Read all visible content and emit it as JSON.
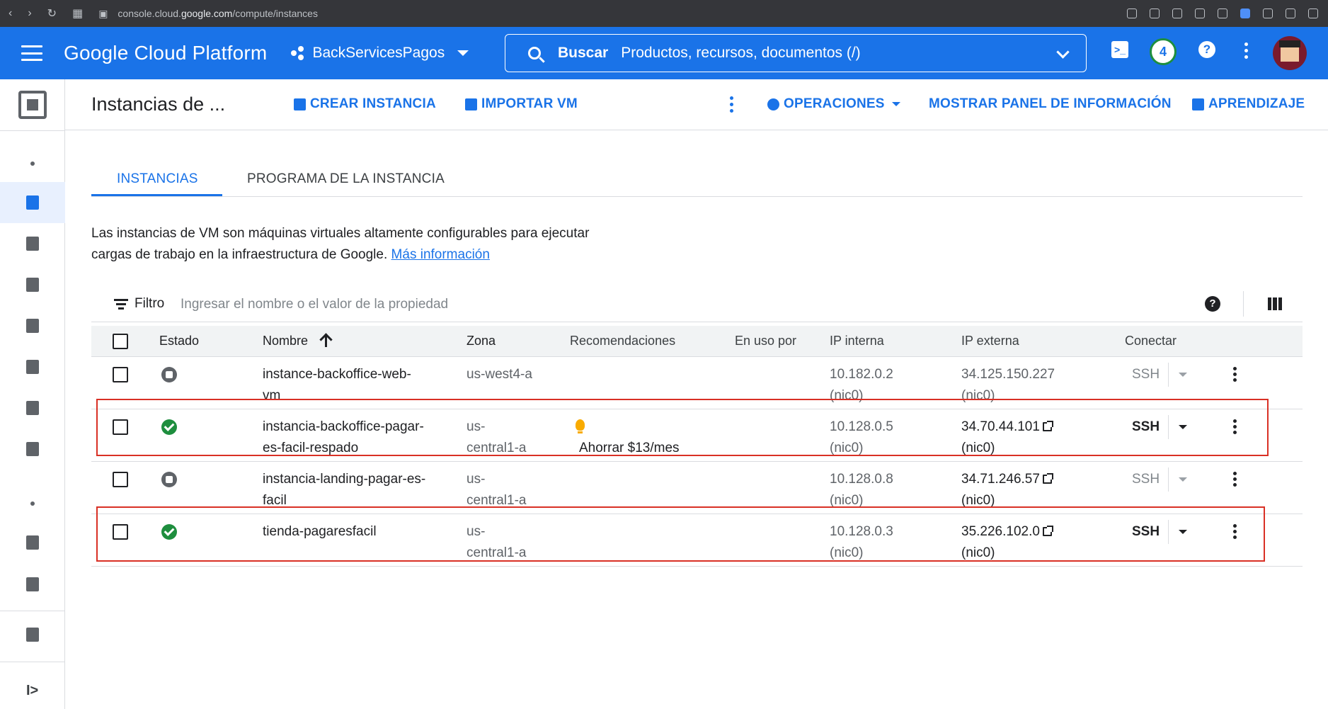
{
  "browser": {
    "url_prefix": "console.cloud.",
    "url_domain": "google.com",
    "url_path": "/compute/instances"
  },
  "header": {
    "brand": "Google Cloud Platform",
    "project": "BackServicesPagos",
    "search_label": "Buscar",
    "search_placeholder": "Productos, recursos, documentos (/)",
    "notification_count": "4",
    "shell_glyph": ">_",
    "help_glyph": "?"
  },
  "toolbar": {
    "title": "Instancias de ...",
    "create_instance": "CREAR INSTANCIA",
    "import_vm": "IMPORTAR VM",
    "operations": "OPERACIONES",
    "show_info_panel": "MOSTRAR PANEL DE INFORMACIÓN",
    "learning": "APRENDIZAJE"
  },
  "tabs": [
    {
      "label": "INSTANCIAS",
      "active": true
    },
    {
      "label": "PROGRAMA DE LA INSTANCIA",
      "active": false
    }
  ],
  "description": {
    "text": "Las instancias de VM son máquinas virtuales altamente configurables para ejecutar cargas de trabajo en la infraestructura de Google.",
    "link": "Más información"
  },
  "filter": {
    "label": "Filtro",
    "placeholder": "Ingresar el nombre o el valor de la propiedad",
    "help_glyph": "?"
  },
  "table": {
    "headers": {
      "status": "Estado",
      "name": "Nombre",
      "zone": "Zona",
      "recommendations": "Recomendaciones",
      "in_use_by": "En uso por",
      "internal_ip": "IP interna",
      "external_ip": "IP externa",
      "connect": "Conectar"
    },
    "rows": [
      {
        "status": "stopped",
        "name_l1": "instance-backoffice-web-",
        "name_l2": "vm",
        "zone_l1": "us-west4-a",
        "zone_l2": "",
        "recommendation": "",
        "internal_ip": "10.182.0.2",
        "internal_nic": "(nic0)",
        "external_ip": "34.125.150.227",
        "external_nic": "(nic0)",
        "connect": "SSH"
      },
      {
        "status": "running",
        "name_l1": "instancia-backoffice-pagar-",
        "name_l2": "es-facil-respado",
        "zone_l1": "us-",
        "zone_l2": "central1-a",
        "recommendation": "Ahorrar $13/mes",
        "internal_ip": "10.128.0.5",
        "internal_nic": "(nic0)",
        "external_ip": "34.70.44.101",
        "external_nic": "(nic0)",
        "connect": "SSH"
      },
      {
        "status": "stopped",
        "name_l1": "instancia-landing-pagar-es-",
        "name_l2": "facil",
        "zone_l1": "us-",
        "zone_l2": "central1-a",
        "recommendation": "",
        "internal_ip": "10.128.0.8",
        "internal_nic": "(nic0)",
        "external_ip": "34.71.246.57",
        "external_nic": "(nic0)",
        "connect": "SSH"
      },
      {
        "status": "running",
        "name_l1": "tienda-pagaresfacil",
        "name_l2": "",
        "zone_l1": "us-",
        "zone_l2": "central1-a",
        "recommendation": "",
        "internal_ip": "10.128.0.3",
        "internal_nic": "(nic0)",
        "external_ip": "35.226.102.0",
        "external_nic": "(nic0)",
        "connect": "SSH"
      }
    ]
  },
  "sidebar": {
    "collapse_glyph": "I>"
  },
  "colors": {
    "accent": "#1a73e8",
    "running": "#1e8e3e",
    "stopped": "#5f6368",
    "highlight": "#d93025",
    "bulb": "#f9ab00"
  }
}
